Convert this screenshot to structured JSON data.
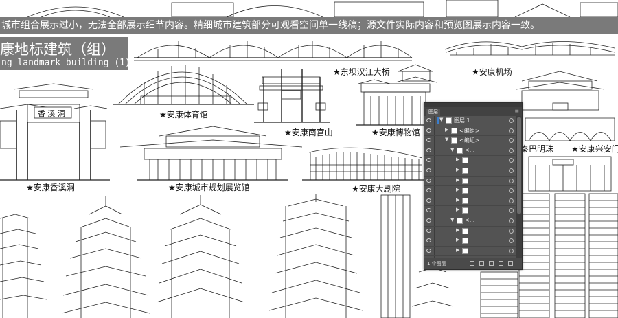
{
  "notice": "城市组合展示过小，无法全部展示细节内容。精细城市建筑部分可观看空间单一线稿；源文件实际内容和预览图展示内容一致。",
  "title": {
    "main": "康地标建筑（组）",
    "sub": "ng landmark building (1)"
  },
  "landmarks": [
    {
      "id": "bridge",
      "label": "★东坝汉江大桥"
    },
    {
      "id": "airport",
      "label": "★安康机场"
    },
    {
      "id": "stadium",
      "label": "★安康体育馆"
    },
    {
      "id": "xiangxi",
      "label": "★安康香溪洞"
    },
    {
      "id": "nangong",
      "label": "★安康南宫山"
    },
    {
      "id": "museum",
      "label": "★安康博物馆"
    },
    {
      "id": "qinba",
      "label": "秦巴明珠"
    },
    {
      "id": "xingan",
      "label": "★安康兴安门"
    },
    {
      "id": "planning",
      "label": "★安康城市规划展览馆"
    },
    {
      "id": "theater",
      "label": "★安康大剧院"
    }
  ],
  "signs": {
    "xiangxi": "香 溪 洞"
  },
  "layers_panel": {
    "tab": "图层",
    "menu_icon": "panel-menu-icon",
    "rows": [
      {
        "name": "图层 1",
        "indent": 0,
        "expanded": true,
        "selected": true
      },
      {
        "name": "<编组>",
        "indent": 1,
        "expanded": false
      },
      {
        "name": "<编组>",
        "indent": 1,
        "expanded": true
      },
      {
        "name": "<...",
        "indent": 2,
        "expanded": true
      },
      {
        "name": "",
        "indent": 3
      },
      {
        "name": "",
        "indent": 3
      },
      {
        "name": "",
        "indent": 3
      },
      {
        "name": "",
        "indent": 3
      },
      {
        "name": "",
        "indent": 3
      },
      {
        "name": "",
        "indent": 3
      },
      {
        "name": "<...",
        "indent": 2,
        "expanded": true
      },
      {
        "name": "",
        "indent": 3
      },
      {
        "name": "",
        "indent": 3
      },
      {
        "name": "",
        "indent": 3
      },
      {
        "name": "",
        "indent": 3
      }
    ],
    "footer": "1 个图层"
  },
  "colors": {
    "banner": "#7a7a7a",
    "panel_bg": "#535353",
    "panel_select": "#3a7fd0",
    "line_art": "#222222"
  }
}
